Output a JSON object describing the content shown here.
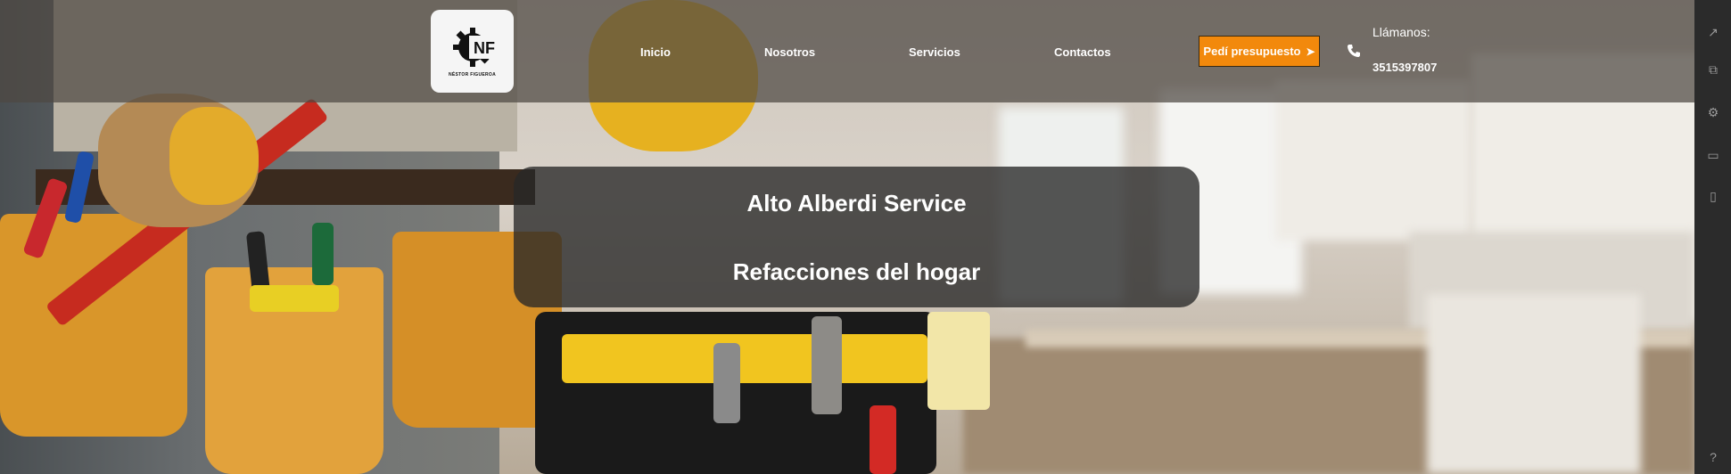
{
  "logo": {
    "initials": "NF",
    "subtitle": "NÉSTOR FIGUEROA",
    "icon": "gear-icon"
  },
  "nav": {
    "items": [
      {
        "label": "Inicio"
      },
      {
        "label": "Nosotros"
      },
      {
        "label": "Servicios"
      },
      {
        "label": "Contactos"
      }
    ]
  },
  "cta": {
    "label": "Pedí presupuesto",
    "icon": "arrow-right-icon",
    "color": "#f2890c"
  },
  "contact": {
    "label": "Llámanos:",
    "number": "3515397807",
    "icon": "phone-icon"
  },
  "hero": {
    "title": "Alto Alberdi Service",
    "subtitle": "Refacciones del hogar"
  },
  "side_toolbar": {
    "icons": [
      "expand-icon",
      "extensions-icon",
      "settings-icon",
      "window-icon",
      "clipboard-icon",
      "help-icon"
    ]
  }
}
